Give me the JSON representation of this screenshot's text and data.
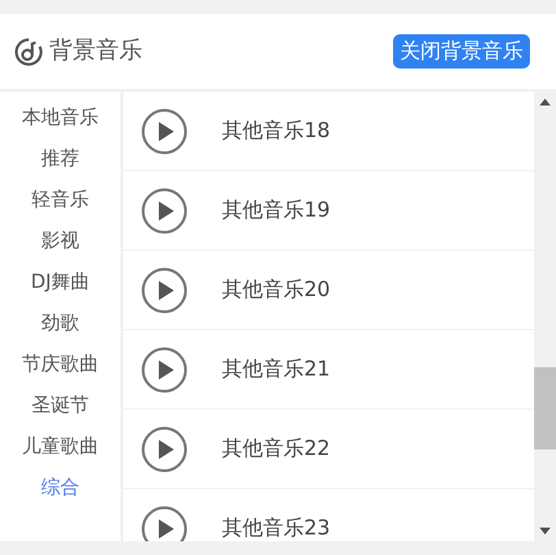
{
  "header": {
    "title": "背景音乐",
    "button": "关闭背景音乐"
  },
  "categories": [
    {
      "label": "本地音乐",
      "selected": false
    },
    {
      "label": "推荐",
      "selected": false
    },
    {
      "label": "轻音乐",
      "selected": false
    },
    {
      "label": "影视",
      "selected": false
    },
    {
      "label": "DJ舞曲",
      "selected": false
    },
    {
      "label": "劲歌",
      "selected": false
    },
    {
      "label": "节庆歌曲",
      "selected": false
    },
    {
      "label": "圣诞节",
      "selected": false
    },
    {
      "label": "儿童歌曲",
      "selected": false
    },
    {
      "label": "综合",
      "selected": true
    }
  ],
  "tracks": [
    {
      "title": "其他音乐18"
    },
    {
      "title": "其他音乐19"
    },
    {
      "title": "其他音乐20"
    },
    {
      "title": "其他音乐21"
    },
    {
      "title": "其他音乐22"
    },
    {
      "title": "其他音乐23"
    }
  ]
}
